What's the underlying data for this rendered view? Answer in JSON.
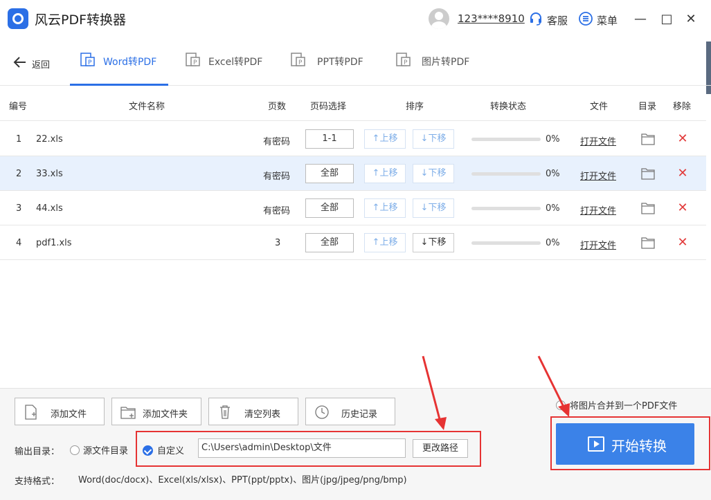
{
  "titlebar": {
    "app_title": "风云PDF转换器",
    "user": "123****8910",
    "customer_service": "客服",
    "menu": "菜单",
    "minimize": "—",
    "maximize": "□",
    "close": "✕"
  },
  "nav": {
    "back": "返回",
    "tabs": [
      {
        "label": "Word转PDF",
        "active": true
      },
      {
        "label": "Excel转PDF",
        "active": false
      },
      {
        "label": "PPT转PDF",
        "active": false
      },
      {
        "label": "图片转PDF",
        "active": false
      }
    ]
  },
  "table": {
    "headers": {
      "num": "编号",
      "name": "文件名称",
      "pages": "页数",
      "page_select": "页码选择",
      "sort": "排序",
      "status": "转换状态",
      "file": "文件",
      "dir": "目录",
      "remove": "移除"
    },
    "up_label": "↑上移",
    "down_label": "↓下移",
    "open_label": "打开文件",
    "remove_icon": "✕",
    "rows": [
      {
        "num": "1",
        "name": "22.xls",
        "pages": "有密码",
        "page_select": "1-1",
        "progress": "0%"
      },
      {
        "num": "2",
        "name": "33.xls",
        "pages": "有密码",
        "page_select": "全部",
        "progress": "0%"
      },
      {
        "num": "3",
        "name": "44.xls",
        "pages": "有密码",
        "page_select": "全部",
        "progress": "0%"
      },
      {
        "num": "4",
        "name": "pdf1.xls",
        "pages": "3",
        "page_select": "全部",
        "progress": "0%"
      }
    ]
  },
  "bottom": {
    "add_file": "添加文件",
    "add_folder": "添加文件夹",
    "clear_list": "清空列表",
    "history": "历史记录",
    "merge_option": "将图片合并到一个PDF文件",
    "output_label": "输出目录：",
    "source_dir": "源文件目录",
    "custom": "自定义",
    "path_value": "C:\\Users\\admin\\Desktop\\文件",
    "change_path": "更改路径",
    "formats_label": "支持格式：",
    "formats": "Word(doc/docx)、Excel(xls/xlsx)、PPT(ppt/pptx)、图片(jpg/jpeg/png/bmp)",
    "start": "开始转换"
  },
  "colors": {
    "accent": "#2b6fe6",
    "annotation": "#e63333",
    "danger": "#e23b3b"
  }
}
